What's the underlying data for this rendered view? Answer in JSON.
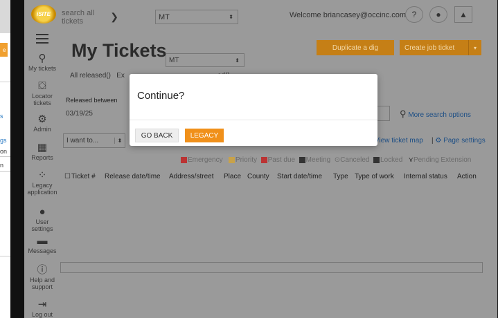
{
  "header": {
    "logo_text": "iSITE",
    "search_select": "search all tickets",
    "state_select": "MT",
    "welcome": "Welcome briancasey@occinc.com",
    "icons": [
      "help-icon",
      "chat-icon",
      "user-icon"
    ]
  },
  "sidebar": {
    "items": [
      {
        "label": "My tickets",
        "icon": "user-pin-icon"
      },
      {
        "label": "Locator tickets",
        "icon": "locator-icon"
      },
      {
        "label": "Admin",
        "icon": "admin-icon"
      },
      {
        "label": "Reports",
        "icon": "reports-icon"
      },
      {
        "label": "Legacy application",
        "icon": "legacy-icon"
      },
      {
        "label": "User settings",
        "icon": "person-icon"
      },
      {
        "label": "Messages",
        "icon": "message-icon"
      },
      {
        "label": "Help and support",
        "icon": "help-icon"
      },
      {
        "label": "Log out",
        "icon": "logout-icon"
      }
    ]
  },
  "main": {
    "title": "My Tickets",
    "title_select": "MT",
    "subtitle_prefix": "All released()",
    "subtitle_partial": "Ex",
    "subtitle_tail": "ed()",
    "duplicate_button": "Duplicate a dig",
    "create_button": "Create job ticket",
    "released_between_label": "Released between",
    "released_from": "03/19/25",
    "more_search": "More search options",
    "i_want_to": "I want to...",
    "view_map": "View ticket map",
    "page_settings": "Page settings",
    "legend": [
      "Emergency",
      "Priority",
      "Past due",
      "Meeting",
      "Canceled",
      "Locked",
      "Pending Extension"
    ],
    "columns": [
      "Ticket #",
      "Release date/time",
      "Address/street",
      "Place",
      "County",
      "Start date/time",
      "Type",
      "Type of work",
      "Internal status",
      "Action"
    ]
  },
  "modal": {
    "title": "Continue?",
    "back_label": "GO BACK",
    "legacy_label": "LEGACY"
  },
  "left_window": {
    "snippets": [
      "e",
      "s",
      "gs",
      "on",
      "n"
    ]
  },
  "colors": {
    "accent_orange": "#f0901a",
    "link_blue": "#2b7bc4"
  }
}
